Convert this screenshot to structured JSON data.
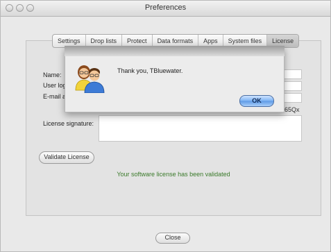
{
  "window": {
    "title": "Preferences"
  },
  "tabs": [
    "Settings",
    "Drop lists",
    "Protect",
    "Data formats",
    "Apps",
    "System files",
    "License"
  ],
  "active_tab": "License",
  "form": {
    "name_label": "Name:",
    "user_login_label": "User log",
    "email_label": "E-mail a",
    "license_key_visible_text": "65Qx",
    "license_signature_label": "License signature:"
  },
  "validate_button_label": "Validate License",
  "validated_message": "Your software license has been validated",
  "close_button_label": "Close",
  "alert": {
    "message": "Thank you, TBluewater.",
    "ok_label": "OK",
    "icon": "users-icon"
  },
  "colors": {
    "success_text": "#3a7a2a",
    "ok_button": "#5e9ae6"
  }
}
